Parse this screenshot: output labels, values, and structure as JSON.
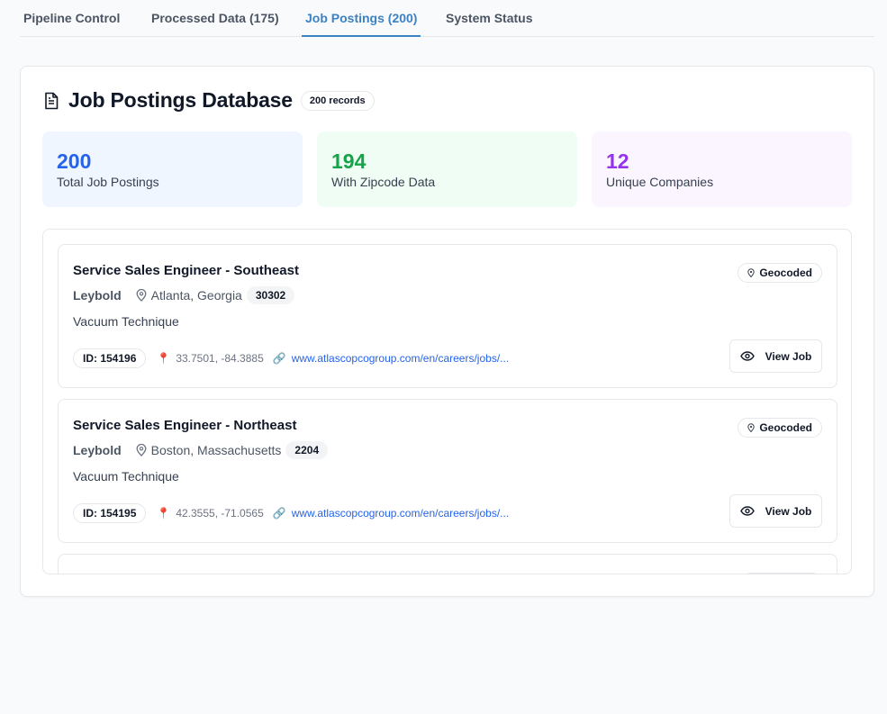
{
  "tabs": [
    {
      "label": "Pipeline Control"
    },
    {
      "label": "Processed Data (175)"
    },
    {
      "label": "Job Postings (200)"
    },
    {
      "label": "System Status"
    }
  ],
  "header": {
    "title": "Job Postings Database",
    "records_badge": "200 records"
  },
  "stats": [
    {
      "value": "200",
      "label": "Total Job Postings",
      "color": "#2563eb",
      "bg": "#eff6ff"
    },
    {
      "value": "194",
      "label": "With Zipcode Data",
      "color": "#16a34a",
      "bg": "#f0fdf4"
    },
    {
      "value": "12",
      "label": "Unique Companies",
      "color": "#9333ea",
      "bg": "#faf5ff"
    }
  ],
  "jobs": [
    {
      "title": "Service Sales Engineer - Southeast",
      "company": "Leybold",
      "location": "Atlanta, Georgia",
      "zip": "30302",
      "department": "Vacuum Technique",
      "id": "ID: 154196",
      "coords": "33.7501, -84.3885",
      "url": "www.atlascopcogroup.com/en/careers/jobs/...",
      "geo_badge": "Geocoded",
      "view_label": "View Job"
    },
    {
      "title": "Service Sales Engineer - Northeast",
      "company": "Leybold",
      "location": "Boston, Massachusetts",
      "zip": "2204",
      "department": "Vacuum Technique",
      "id": "ID: 154195",
      "coords": "42.3555, -71.0565",
      "url": "www.atlascopcogroup.com/en/careers/jobs/...",
      "geo_badge": "Geocoded",
      "view_label": "View Job"
    }
  ],
  "colors": {
    "accent": "#3b82c4",
    "link": "#2563eb",
    "pin": "#e5436a"
  }
}
